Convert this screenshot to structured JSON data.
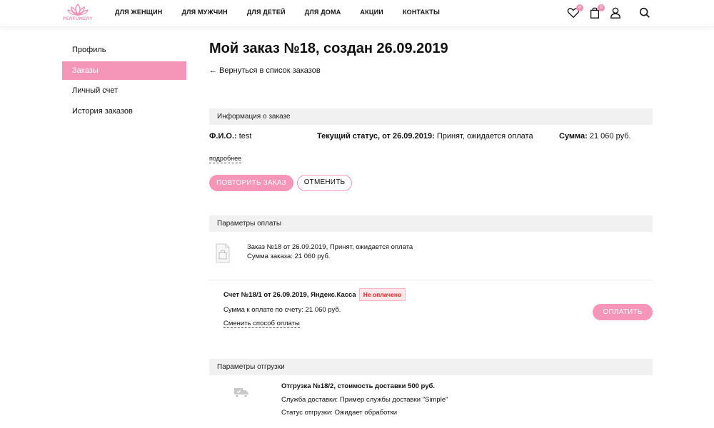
{
  "header": {
    "logo_text": "PERFUMERY",
    "nav": [
      "ДЛЯ ЖЕНЩИН",
      "ДЛЯ МУЖЧИН",
      "ДЛЯ ДЕТЕЙ",
      "ДЛЯ ДОМА",
      "АКЦИИ",
      "КОНТАКТЫ"
    ],
    "wishlist_count": "0",
    "cart_count": "0"
  },
  "sidebar": {
    "items": [
      {
        "label": "Профиль"
      },
      {
        "label": "Заказы"
      },
      {
        "label": "Личный счет"
      },
      {
        "label": "История заказов"
      }
    ],
    "active_index": 1
  },
  "main": {
    "title": "Мой заказ №18, создан 26.09.2019",
    "back_link": "← Вернуться в список заказов",
    "info": {
      "section_title": "Информация о заказе",
      "fio_label": "Ф.И.О.:",
      "fio_value": "test",
      "status_label": "Текущий статус, от 26.09.2019:",
      "status_value": "Принят, ожидается оплата",
      "sum_label": "Сумма:",
      "sum_value": "21 060 руб.",
      "more_link": "подробнее",
      "repeat_button": "ПОВТОРИТЬ ЗАКАЗ",
      "cancel_button": "ОТМЕНИТЬ"
    },
    "payment": {
      "section_title": "Параметры оплаты",
      "order_line": "Заказ №18 от 26.09.2019, Принят, ожидается оплата",
      "order_sum": "Сумма заказа: 21 060 руб.",
      "invoice_title": "Счет №18/1 от 26.09.2019, Яндекс.Касса",
      "invoice_status": "Не оплачено",
      "invoice_sum": "Сумма к оплате по счету: 21 060 руб.",
      "change_method": "Сменить способ оплаты",
      "pay_button": "ОПЛАТИТЬ"
    },
    "shipment": {
      "section_title": "Параметры отгрузки",
      "title": "Отгрузка №18/2, стоимость доставки 500 руб.",
      "service": "Служба доставки: Пример службы доставки \"Simple\"",
      "status": "Статус отгрузки: Ожидает обработки"
    }
  },
  "colors": {
    "accent": "#f596b8",
    "section_bg": "#f1f1f1",
    "unpaid_text": "#d22222"
  }
}
